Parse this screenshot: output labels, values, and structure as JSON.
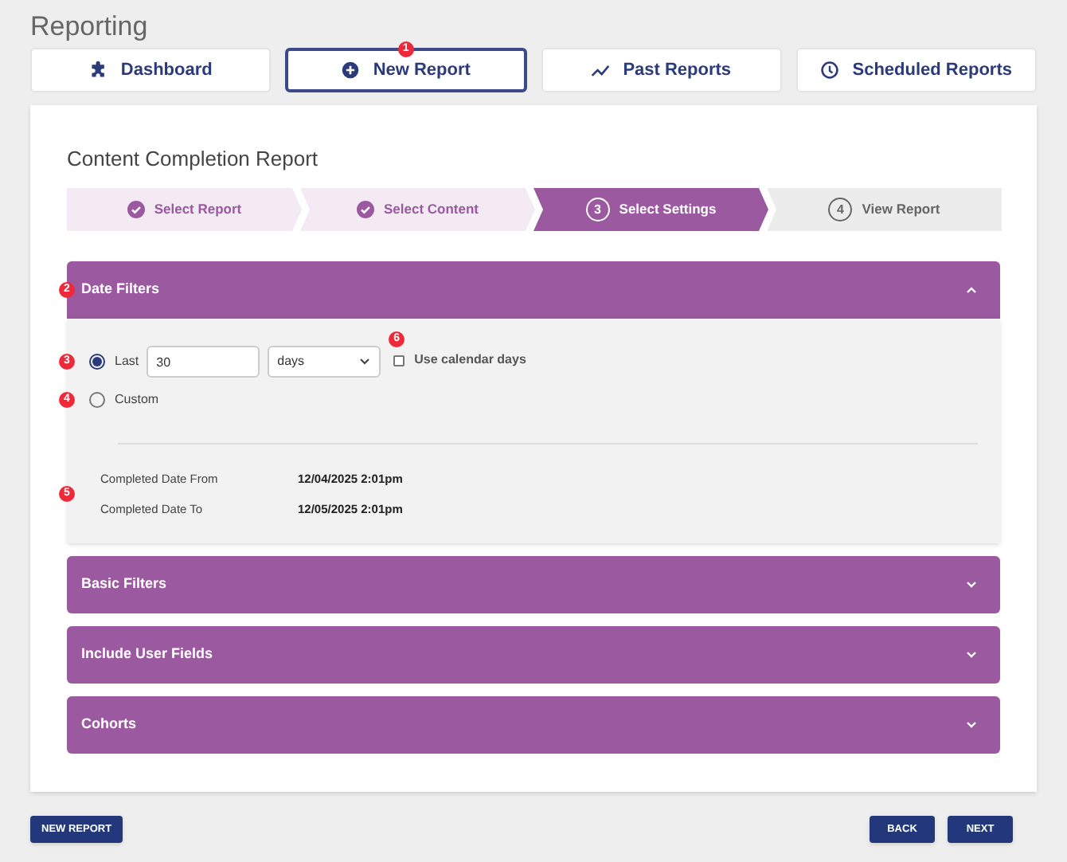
{
  "page_title": "Reporting",
  "tabs": [
    {
      "label": "Dashboard",
      "selected": false
    },
    {
      "label": "New Report",
      "selected": true,
      "badge": "1"
    },
    {
      "label": "Past Reports",
      "selected": false
    },
    {
      "label": "Scheduled Reports",
      "selected": false
    }
  ],
  "report_title": "Content Completion Report",
  "steps": [
    {
      "label": "Select Report",
      "kind": "done"
    },
    {
      "label": "Select Content",
      "kind": "done"
    },
    {
      "number": "3",
      "label": "Select Settings",
      "kind": "active"
    },
    {
      "number": "4",
      "label": "View Report",
      "kind": "pending"
    }
  ],
  "sections": [
    {
      "title": "Date Filters",
      "expanded": true,
      "badge": "2"
    },
    {
      "title": "Basic Filters",
      "expanded": false
    },
    {
      "title": "Include User Fields",
      "expanded": false
    },
    {
      "title": "Cohorts",
      "expanded": false
    }
  ],
  "date_filters": {
    "options": [
      {
        "label": "Last",
        "selected": true,
        "badge": "3"
      },
      {
        "label": "Custom",
        "selected": false,
        "badge": "4"
      }
    ],
    "amount": "30",
    "unit": "days",
    "calendar_days": {
      "label": "Use calendar days",
      "checked": false,
      "badge": "6"
    },
    "summary_badge": "5",
    "summary": [
      {
        "label": "Completed Date From",
        "value": "12/04/2025 2:01pm"
      },
      {
        "label": "Completed Date To",
        "value": "12/05/2025 2:01pm"
      }
    ]
  },
  "buttons_left": [
    "NEW REPORT"
  ],
  "buttons_right": [
    "BACK",
    "NEXT"
  ]
}
